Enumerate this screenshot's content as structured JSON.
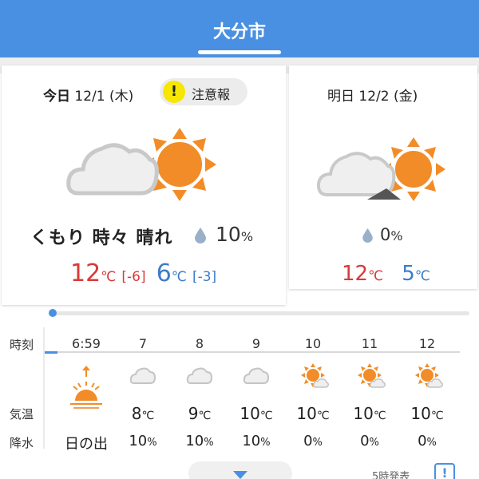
{
  "header": {
    "city": "大分市"
  },
  "today": {
    "label": "今日",
    "date": "12/1 (木)",
    "warning": {
      "icon": "exclamation-icon",
      "icon_glyph": "!",
      "text": "注意報"
    },
    "weather_icon": "cloudy-then-sunny-icon",
    "description": "くもり 時々 晴れ",
    "pop": "10",
    "pop_unit": "%",
    "high": "12",
    "high_diff": "[-6]",
    "low": "6",
    "low_diff": "[-3]",
    "temp_unit": "℃"
  },
  "tomorrow": {
    "label": "明日",
    "date": "12/2 (金)",
    "weather_icon": "cloudy-then-sunny-icon",
    "pop": "0",
    "pop_unit": "%",
    "high": "12",
    "low": "5",
    "temp_unit": "℃"
  },
  "hourly": {
    "labels": {
      "time": "時刻",
      "temp": "気温",
      "rain": "降水"
    },
    "temp_unit": "℃",
    "rain_unit": "%",
    "columns": [
      {
        "time": "6:59",
        "icon": "sunrise-icon",
        "temp": "",
        "rain": "日の出"
      },
      {
        "time": "7",
        "icon": "cloud-icon",
        "temp": "8",
        "rain": "10"
      },
      {
        "time": "8",
        "icon": "cloud-icon",
        "temp": "9",
        "rain": "10"
      },
      {
        "time": "9",
        "icon": "cloud-icon",
        "temp": "10",
        "rain": "10"
      },
      {
        "time": "10",
        "icon": "sun-cloud-icon",
        "temp": "10",
        "rain": "0"
      },
      {
        "time": "11",
        "icon": "sun-cloud-icon",
        "temp": "10",
        "rain": "0"
      },
      {
        "time": "12",
        "icon": "sun-cloud-icon",
        "temp": "10",
        "rain": "0"
      }
    ]
  },
  "footer": {
    "issued": "5時発表",
    "info_glyph": "!"
  },
  "colors": {
    "header": "#4a90e2",
    "high": "#d83a3a",
    "low": "#3d7cc9",
    "sun": "#f28c28",
    "warning": "#f6e600"
  }
}
